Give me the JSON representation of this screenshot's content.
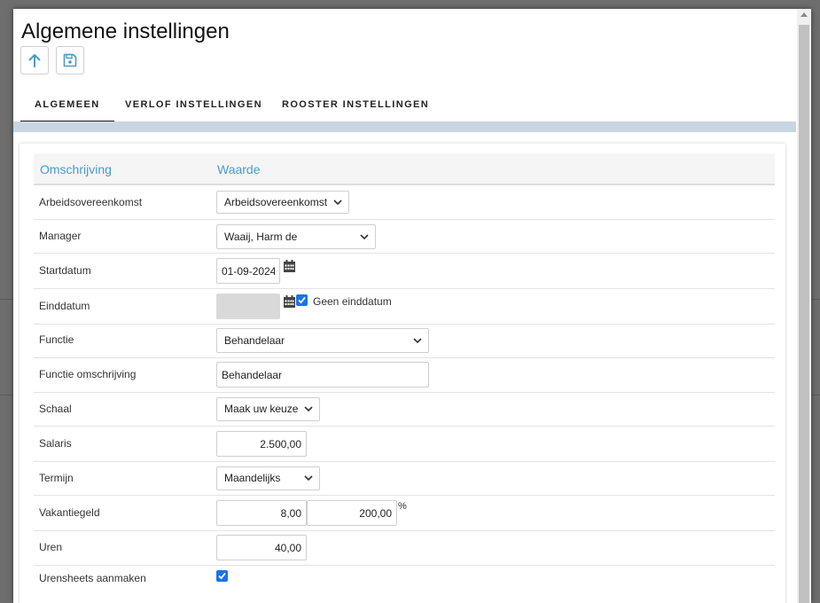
{
  "modal": {
    "title": "Algemene instellingen",
    "toolbar": {
      "upload_icon": "arrow-up-icon",
      "save_icon": "floppy-disk-icon"
    }
  },
  "tabs": [
    {
      "label": "ALGEMEEN",
      "active": true
    },
    {
      "label": "VERLOF INSTELLINGEN",
      "active": false
    },
    {
      "label": "ROOSTER INSTELLINGEN",
      "active": false
    }
  ],
  "table": {
    "header": {
      "description": "Omschrijving",
      "value": "Waarde"
    },
    "rows": {
      "arbeidsovereenkomst": {
        "label": "Arbeidsovereenkomst",
        "value": "Arbeidsovereenkomst"
      },
      "manager": {
        "label": "Manager",
        "value": "Waaij, Harm de"
      },
      "startdatum": {
        "label": "Startdatum",
        "value": "01-09-2024"
      },
      "einddatum": {
        "label": "Einddatum",
        "value": "",
        "checkbox_label": "Geen einddatum",
        "checked": true
      },
      "functie": {
        "label": "Functie",
        "value": "Behandelaar"
      },
      "functie_omschrijving": {
        "label": "Functie omschrijving",
        "value": "Behandelaar"
      },
      "schaal": {
        "label": "Schaal",
        "value": "Maak uw keuze"
      },
      "salaris": {
        "label": "Salaris",
        "value": "2.500,00"
      },
      "termijn": {
        "label": "Termijn",
        "value": "Maandelijks"
      },
      "vakantiegeld": {
        "label": "Vakantiegeld",
        "value": "8,00",
        "value2": "200,00",
        "unit": "%"
      },
      "uren": {
        "label": "Uren",
        "value": "40,00"
      },
      "urensheets": {
        "label": "Urensheets aanmaken",
        "checked": true
      }
    }
  },
  "colors": {
    "accent": "#4a9bc7",
    "checkbox": "#1a73e8",
    "tab_strip": "#c9d5e2"
  }
}
